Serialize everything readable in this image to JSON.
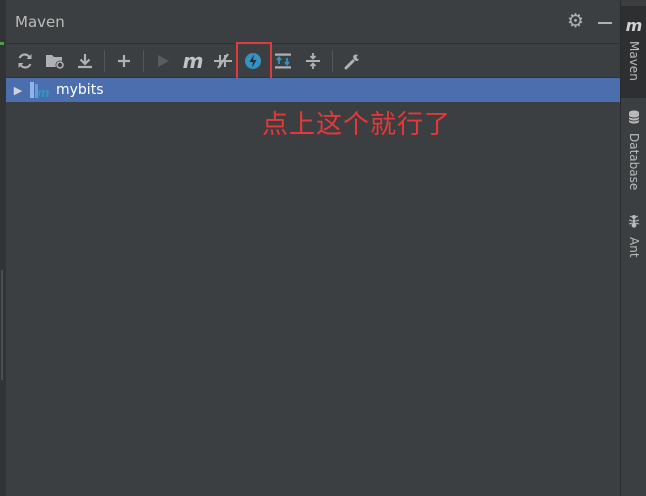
{
  "window": {
    "title": "Maven"
  },
  "toolbar": {
    "buttons": [
      {
        "name": "reload-all",
        "icon": "refresh-icon"
      },
      {
        "name": "generate-sources",
        "icon": "folder-sync-icon"
      },
      {
        "name": "download-sources",
        "icon": "download-icon"
      },
      {
        "name": "add-project",
        "icon": "plus-icon"
      },
      {
        "name": "run",
        "icon": "play-icon",
        "disabled": true
      },
      {
        "name": "execute-goal",
        "icon": "maven-m-icon",
        "label": "m"
      },
      {
        "name": "toggle-offline",
        "icon": "offline-icon"
      },
      {
        "name": "skip-tests",
        "icon": "skip-tests-icon"
      },
      {
        "name": "show-dependencies",
        "icon": "dependencies-icon"
      },
      {
        "name": "collapse-all",
        "icon": "collapse-icon"
      },
      {
        "name": "settings",
        "icon": "wrench-icon"
      }
    ],
    "highlighted": "skip-tests"
  },
  "tree": {
    "projects": [
      {
        "name": "mybits",
        "expanded": false,
        "selected": true
      }
    ]
  },
  "annotation": {
    "text": "点上这个就行了",
    "color": "#e8373a"
  },
  "side_stripe": {
    "items": [
      {
        "label": "Maven",
        "icon": "maven-m-icon",
        "active": true
      },
      {
        "label": "Database",
        "icon": "database-icon"
      },
      {
        "label": "Ant",
        "icon": "ant-icon"
      }
    ]
  },
  "colors": {
    "selection": "#4b6eaf",
    "background": "#3c3f41",
    "highlight_box": "#e0393f"
  }
}
